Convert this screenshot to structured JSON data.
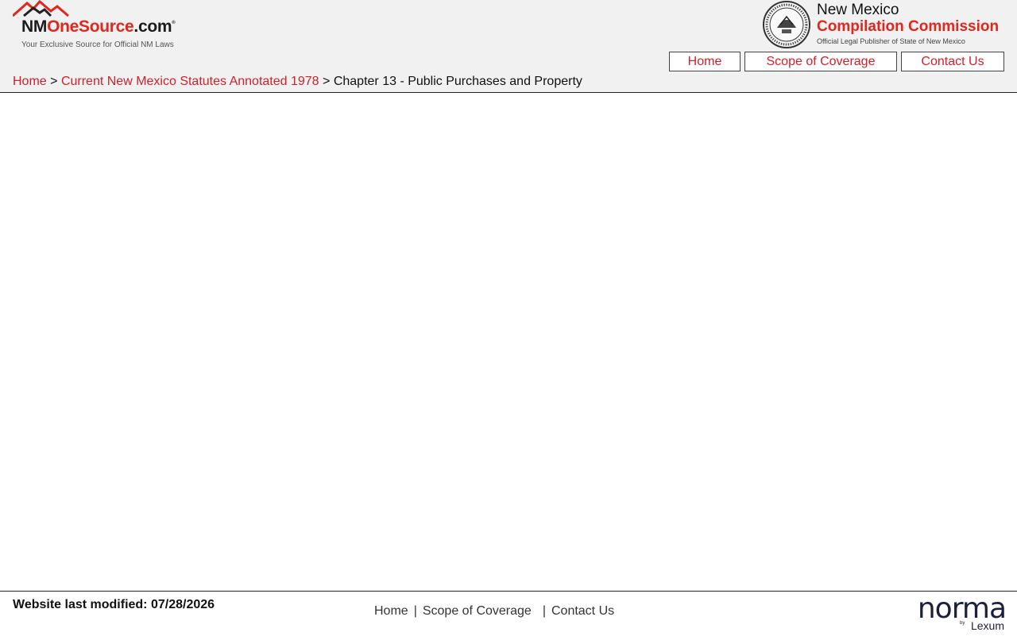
{
  "header": {
    "brand_prefix": "NM",
    "brand_main": "OneSource",
    "brand_suffix": ".com",
    "brand_reg": "®",
    "tagline": "Your Exclusive Source for Official NM Laws",
    "commission_line1": "New Mexico",
    "commission_line2": "Compilation Commission",
    "commission_line3": "Official Legal Publisher of State of New Mexico",
    "nav": [
      {
        "label": "Home"
      },
      {
        "label": "Scope of Coverage"
      },
      {
        "label": "Contact Us"
      }
    ]
  },
  "breadcrumb": {
    "items": [
      {
        "label": "Home"
      },
      {
        "label": "Current New Mexico Statutes Annotated 1978"
      }
    ],
    "separator": ">",
    "current": "Chapter 13 - Public Purchases and Property"
  },
  "footer": {
    "modified": "Website last modified: 07/28/2026",
    "links": [
      {
        "label": "Home"
      },
      {
        "label": "Scope of Coverage"
      },
      {
        "label": "Contact Us"
      }
    ],
    "separator": "|",
    "norma_word": "norma",
    "norma_by": "by",
    "norma_lexum": "Lexum"
  },
  "colors": {
    "accent": "#d0202a",
    "brand_red": "#e2261c",
    "header_bg": "#f1f1f1"
  },
  "icons": {
    "logo": "mountains-logo-icon",
    "seal": "state-seal-icon"
  }
}
